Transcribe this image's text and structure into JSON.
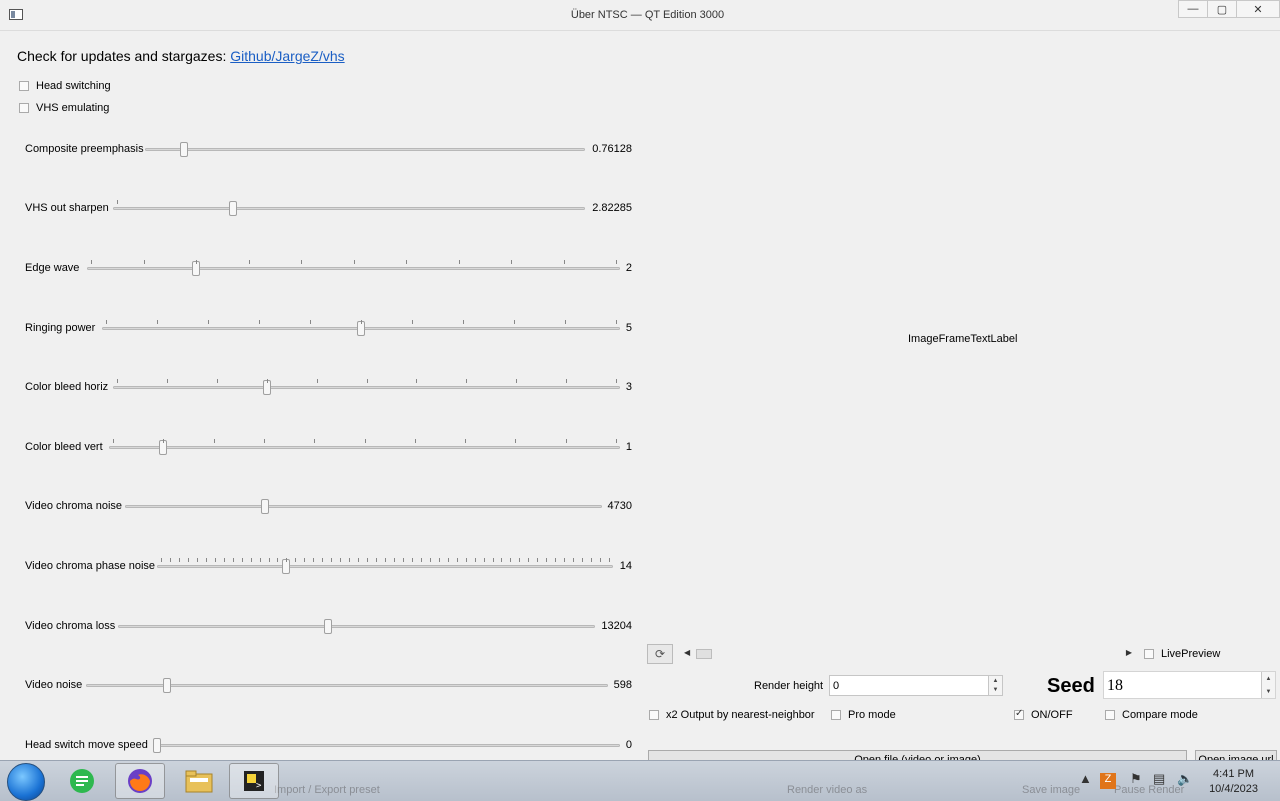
{
  "window": {
    "title": "Über NTSC — QT Edition 3000",
    "minimize": "—",
    "maximize": "▢",
    "close": "✕"
  },
  "header": {
    "prefix": "Check for updates and stargazes: ",
    "link": "Github/JargeZ/vhs"
  },
  "checkboxes": {
    "head_switching": "Head switching",
    "vhs_emulating": "VHS emulating"
  },
  "sliders": [
    {
      "label": "Composite preemphasis",
      "value": "0.76128",
      "level": 0.08
    },
    {
      "label": "VHS out sharpen",
      "value": "2.82285",
      "level": 0.25
    },
    {
      "label": "Edge wave",
      "value": "2",
      "level": 0.2
    },
    {
      "label": "Ringing power",
      "value": "5",
      "level": 0.5
    },
    {
      "label": "Color bleed horiz",
      "value": "3",
      "level": 0.3
    },
    {
      "label": "Color bleed vert",
      "value": "1",
      "level": 0.1
    },
    {
      "label": "Video chroma noise",
      "value": "4730",
      "level": 0.29
    },
    {
      "label": "Video chroma phase noise",
      "value": "14",
      "level": 0.28
    },
    {
      "label": "Video chroma loss",
      "value": "13204",
      "level": 0.44
    },
    {
      "label": "Video noise",
      "value": "598",
      "level": 0.15
    },
    {
      "label": "Head switch move speed",
      "value": "0",
      "level": 0.0
    }
  ],
  "preview": {
    "image_label": "ImageFrameTextLabel",
    "live_preview": "LivePreview"
  },
  "controls": {
    "render_height_label": "Render height",
    "render_height_value": "0",
    "seed_label": "Seed",
    "seed_value": "18",
    "x2_output": "x2 Output by nearest-neighbor",
    "pro_mode": "Pro mode",
    "on_off": "ON/OFF",
    "compare_mode": "Compare mode"
  },
  "buttons": {
    "open_file": "Open file (video or image)",
    "open_image_url": "Open image url",
    "import_export": "Import / Export preset",
    "render_video": "Render video as",
    "save_image": "Save image",
    "pause_render": "Pause Render"
  },
  "taskbar": {
    "time": "4:41 PM",
    "date": "10/4/2023"
  }
}
